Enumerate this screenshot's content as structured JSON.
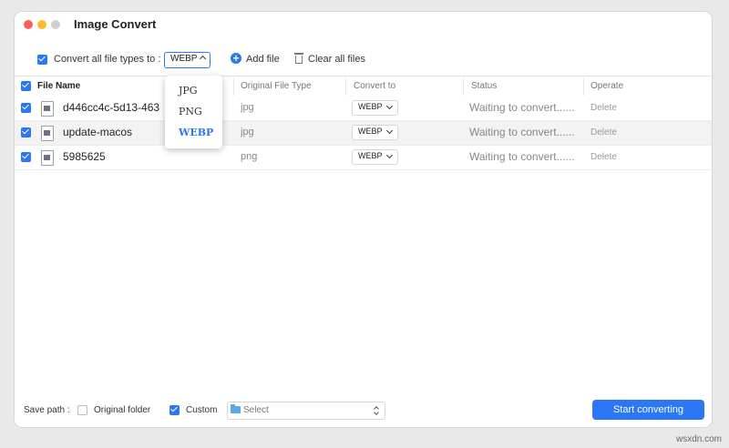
{
  "window": {
    "title": "Image Convert"
  },
  "toolbar": {
    "convert_all_label": "Convert all file types to :",
    "convert_all_checked": true,
    "format_value": "WEBP",
    "add_file_label": "Add file",
    "clear_all_label": "Clear all files"
  },
  "format_dropdown": {
    "options": [
      "JPG",
      "PNG",
      "WEBP"
    ],
    "selected": "WEBP"
  },
  "table": {
    "columns": [
      "File Name",
      "Original File Type",
      "Convert to",
      "Status",
      "Operate"
    ],
    "rows": [
      {
        "name": "d446cc4c-5d13-463",
        "type": "jpg",
        "convert_to": "WEBP",
        "status": "Waiting to convert......",
        "action": "Delete"
      },
      {
        "name": "update-macos",
        "type": "jpg",
        "convert_to": "WEBP",
        "status": "Waiting to convert......",
        "action": "Delete"
      },
      {
        "name": "5985625",
        "type": "png",
        "convert_to": "WEBP",
        "status": "Waiting to convert......",
        "action": "Delete"
      }
    ]
  },
  "footer": {
    "save_path_label": "Save path :",
    "original_folder_label": "Original folder",
    "original_folder_checked": false,
    "custom_label": "Custom",
    "custom_checked": true,
    "select_placeholder": "Select",
    "start_button": "Start converting"
  },
  "watermark": "wsxdn.com",
  "colors": {
    "accent": "#2b77f5"
  }
}
